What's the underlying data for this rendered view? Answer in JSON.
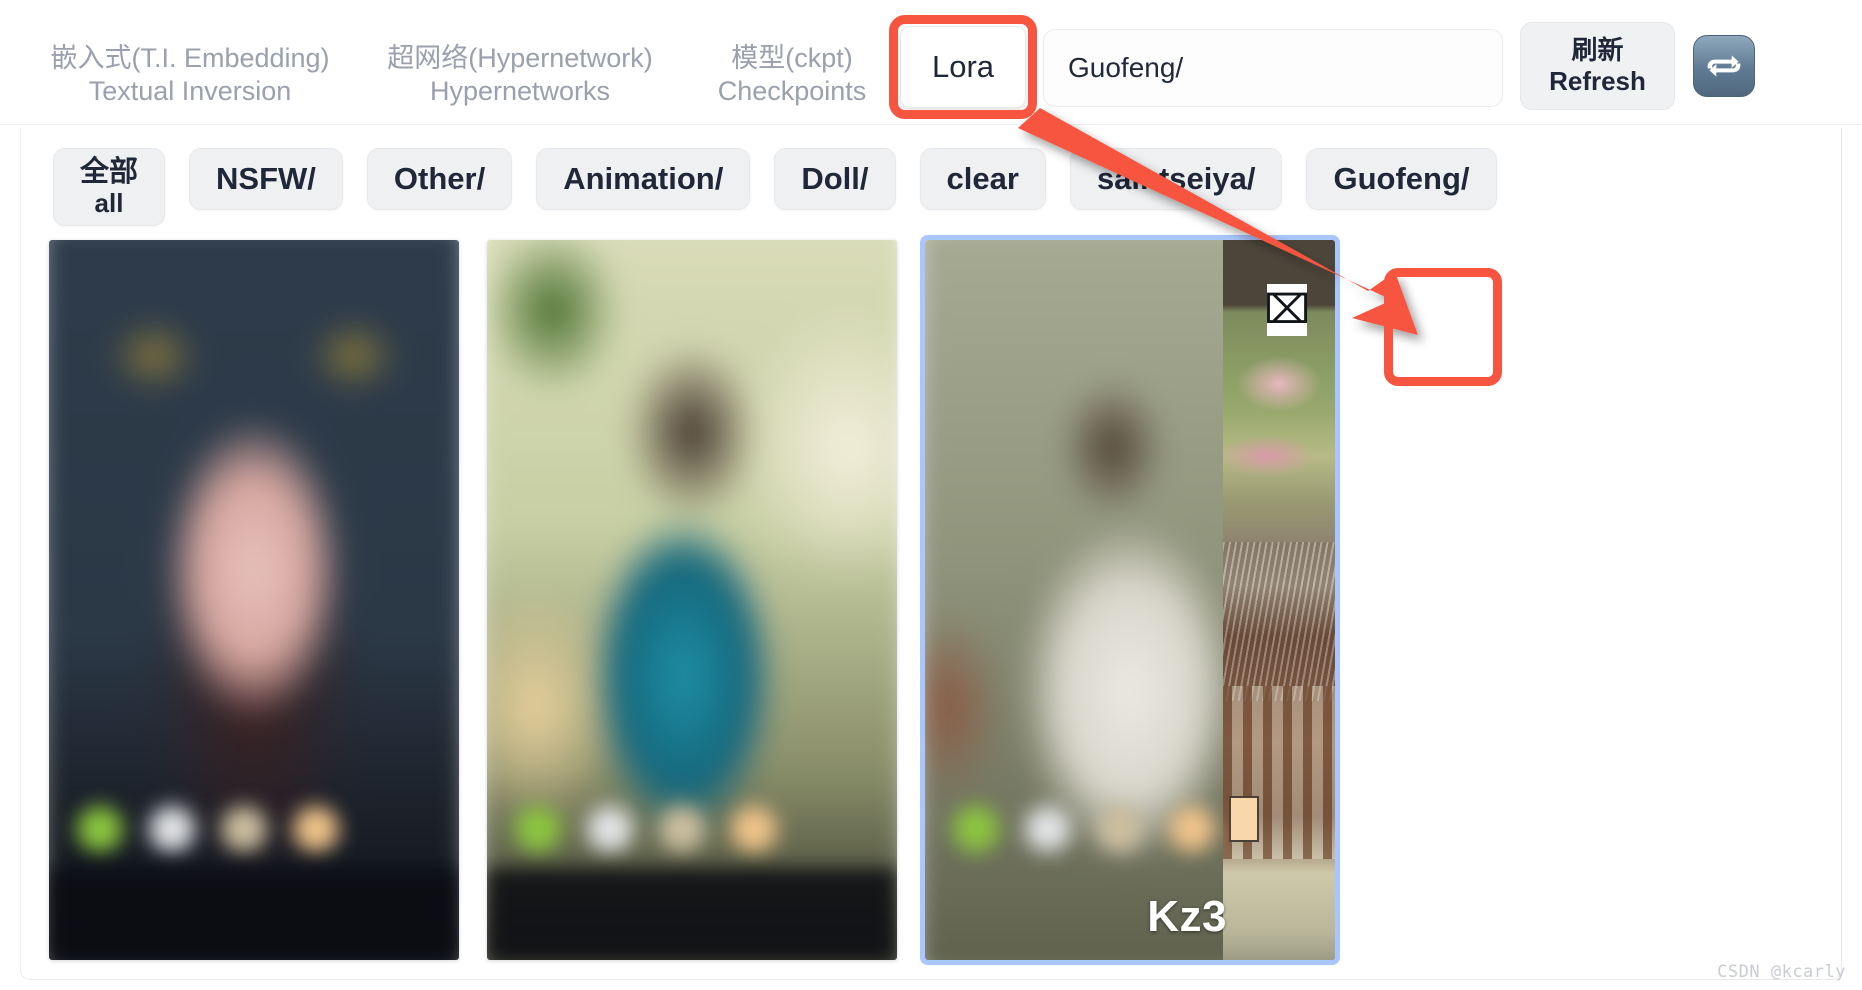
{
  "tabs": [
    {
      "zh": "嵌入式(T.I. Embedding)",
      "en": "Textual Inversion",
      "name": "textual-inversion",
      "selected": false
    },
    {
      "zh": "超网络(Hypernetwork)",
      "en": "Hypernetworks",
      "name": "hypernetworks",
      "selected": false
    },
    {
      "zh": "模型(ckpt)",
      "en": "Checkpoints",
      "name": "checkpoints",
      "selected": false
    }
  ],
  "lora_tab": {
    "label": "Lora",
    "selected": true
  },
  "search": {
    "value": "Guofeng/",
    "placeholder": ""
  },
  "refresh": {
    "zh": "刷新",
    "en": "Refresh",
    "icon": "repeat-icon"
  },
  "chips": [
    {
      "zh": "全部",
      "en": "all",
      "two_line": true,
      "name": "all"
    },
    {
      "label": "NSFW/",
      "two_line": false,
      "name": "nsfw"
    },
    {
      "label": "Other/",
      "two_line": false,
      "name": "other"
    },
    {
      "label": "Animation/",
      "two_line": false,
      "name": "animation"
    },
    {
      "label": "Doll/",
      "two_line": false,
      "name": "doll"
    },
    {
      "label": "clear",
      "two_line": false,
      "name": "clear"
    },
    {
      "label": "saintseiya/",
      "two_line": false,
      "name": "saintseiya"
    },
    {
      "label": "Guofeng/",
      "two_line": false,
      "name": "guofeng"
    }
  ],
  "cards": [
    {
      "name": "model-card-1",
      "caption": "",
      "selected": false,
      "art": "art1"
    },
    {
      "name": "model-card-2",
      "caption": "",
      "selected": false,
      "art": "art2"
    },
    {
      "name": "model-card-3",
      "caption": "Kz3",
      "selected": true,
      "art": "art3"
    }
  ],
  "badge": {
    "glyph": "⌧",
    "icon_name": "missing-glyph-x-icon"
  },
  "annotations": {
    "highlight_color": "#f7553f",
    "lora_box": "red-highlight-box-lora",
    "x_box": "red-highlight-box-x-icon",
    "arrow": "red-arrow-lora-to-x-icon"
  },
  "watermark": "CSDN @kcarly",
  "colors": {
    "accent_red": "#f7553f",
    "selection_blue": "#a9c6ff",
    "chip_bg": "#eff0f2",
    "tab_text": "#9aa0ad",
    "text_dark": "#1f2738"
  }
}
